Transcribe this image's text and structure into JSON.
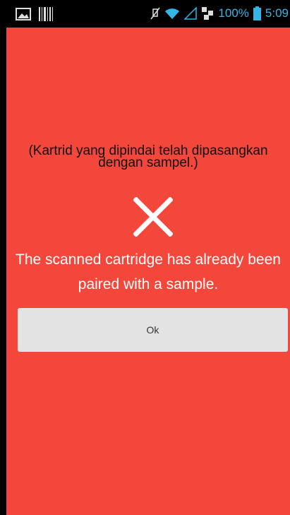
{
  "status_bar": {
    "battery_percent": "100%",
    "time": "5:09",
    "icons": [
      "image-icon",
      "barcode-icon",
      "mute-icon",
      "wifi-icon",
      "signal-icon",
      "network-icon",
      "battery-icon"
    ]
  },
  "dialog": {
    "message_id": "(Kartrid yang dipindai telah dipasangkan dengan sampel.)",
    "message_en": "The scanned cartridge has already been paired with a sample.",
    "ok_label": "Ok",
    "icon": "close-icon"
  },
  "colors": {
    "background": "#f2473a",
    "button": "#e3e3e3",
    "status_accent": "#33b5e5"
  }
}
